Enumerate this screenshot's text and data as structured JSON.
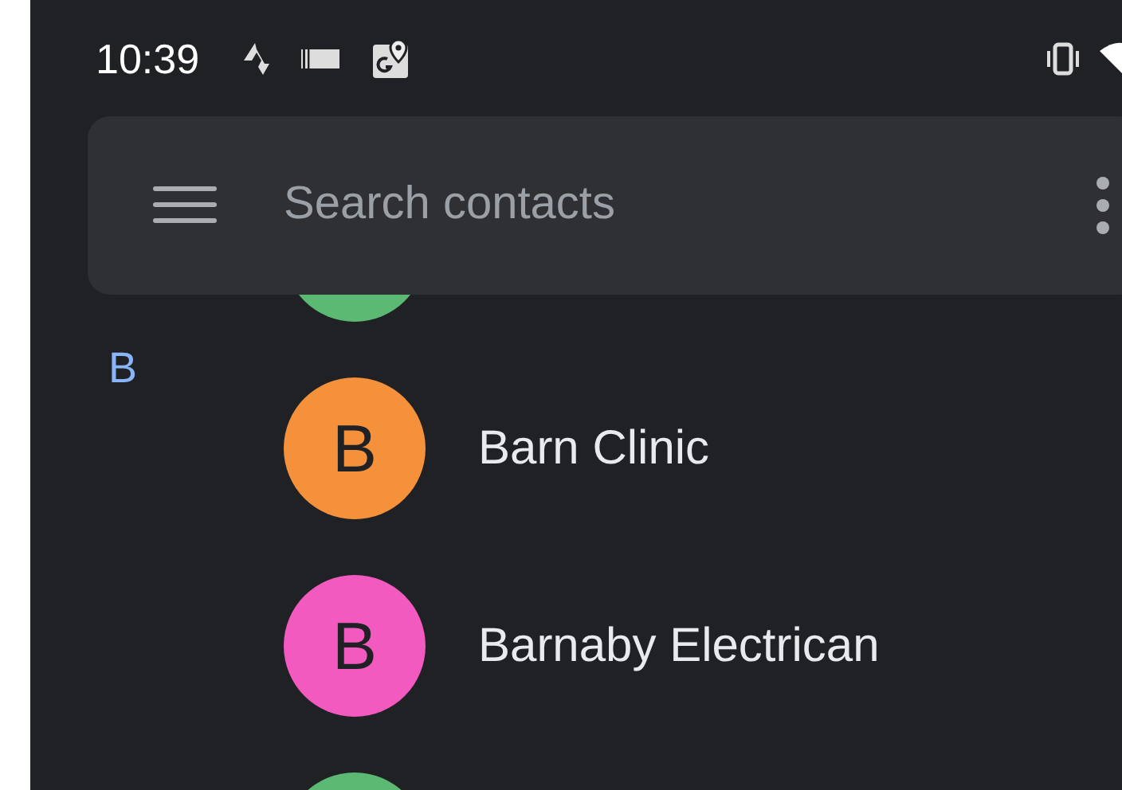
{
  "status_bar": {
    "time": "10:39"
  },
  "search": {
    "placeholder": "Search contacts"
  },
  "section_letter": "B",
  "contacts": [
    {
      "kind": "clipped_top",
      "color": "#5bb974"
    },
    {
      "kind": "contact",
      "initial": "B",
      "name": "Barn Clinic",
      "color": "#f6913b"
    },
    {
      "kind": "contact",
      "initial": "B",
      "name": "Barnaby Electrican",
      "color": "#f25ac0"
    },
    {
      "kind": "clipped_bottom",
      "color": "#5bb974"
    }
  ]
}
